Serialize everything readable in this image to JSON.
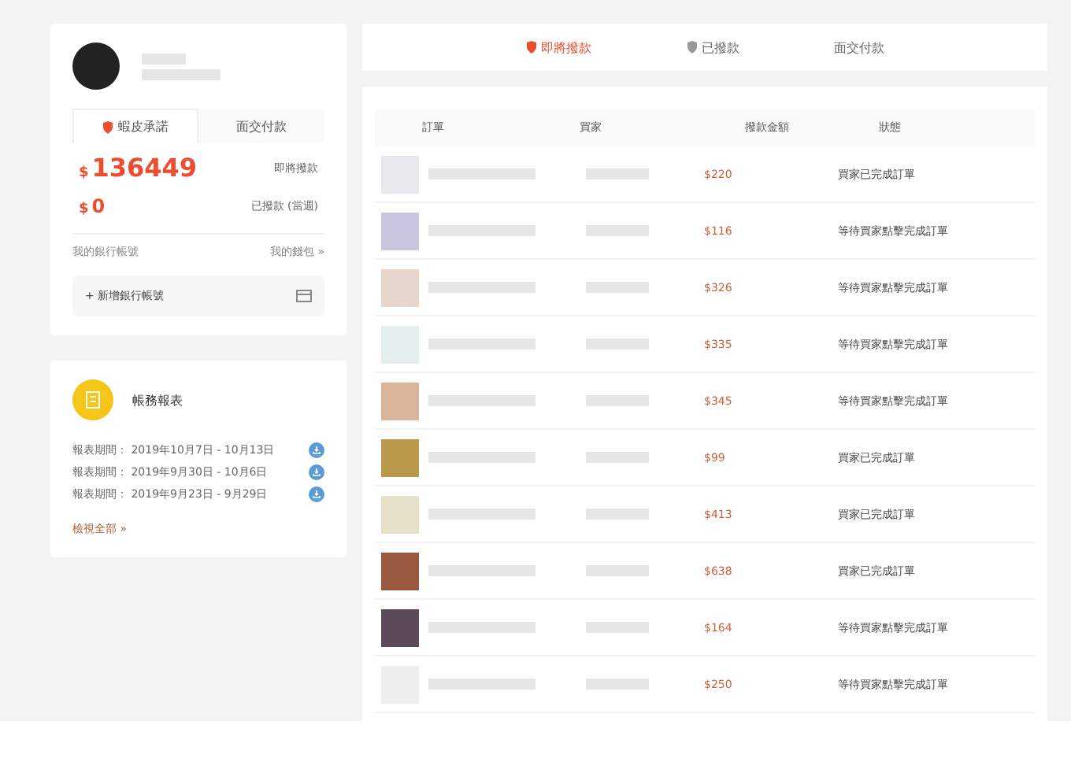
{
  "wallet": {
    "tabs": [
      {
        "label": "蝦皮承諾",
        "selected": true
      },
      {
        "label": "面交付款",
        "selected": false
      }
    ],
    "balances": [
      {
        "amount": "136449",
        "label": "即將撥款",
        "kind": "primary"
      },
      {
        "amount": "0",
        "label": "已撥款 (當週)",
        "kind": "secondary"
      }
    ],
    "currency": "$",
    "bank_label": "我的銀行帳號",
    "wallet_link": "我的錢包 »",
    "add_bank": "+ 新增銀行帳號"
  },
  "reports": {
    "title": "帳務報表",
    "items": [
      "報表期間： 2019年10月7日 - 10月13日",
      "報表期間： 2019年9月30日 - 10月6日",
      "報表期間： 2019年9月23日 - 9月29日"
    ],
    "view_all": "檢視全部 »"
  },
  "tabs": [
    {
      "label": "即將撥款",
      "selected": true
    },
    {
      "label": "已撥款",
      "selected": false
    },
    {
      "label": "面交付款",
      "selected": false
    }
  ],
  "table": {
    "columns": [
      "訂單",
      "買家",
      "撥款金額",
      "狀態"
    ],
    "rows": [
      {
        "amount": "$220",
        "status": "買家已完成訂單",
        "color": "#e8e8ec"
      },
      {
        "amount": "$116",
        "status": "等待買家點擊完成訂單",
        "color": "#c9c6e0"
      },
      {
        "amount": "$326",
        "status": "等待買家點擊完成訂單",
        "color": "#e6d6cc"
      },
      {
        "amount": "$335",
        "status": "等待買家點擊完成訂單",
        "color": "#e4eeec"
      },
      {
        "amount": "$345",
        "status": "等待買家點擊完成訂單",
        "color": "#d9b49a"
      },
      {
        "amount": "$99",
        "status": "買家已完成訂單",
        "color": "#b89a4a"
      },
      {
        "amount": "$413",
        "status": "買家已完成訂單",
        "color": "#e8e2cc"
      },
      {
        "amount": "$638",
        "status": "買家已完成訂單",
        "color": "#9a5a40"
      },
      {
        "amount": "$164",
        "status": "等待買家點擊完成訂單",
        "color": "#5a4a5a"
      },
      {
        "amount": "$250",
        "status": "等待買家點擊完成訂單",
        "color": "#eeeeee"
      }
    ]
  }
}
